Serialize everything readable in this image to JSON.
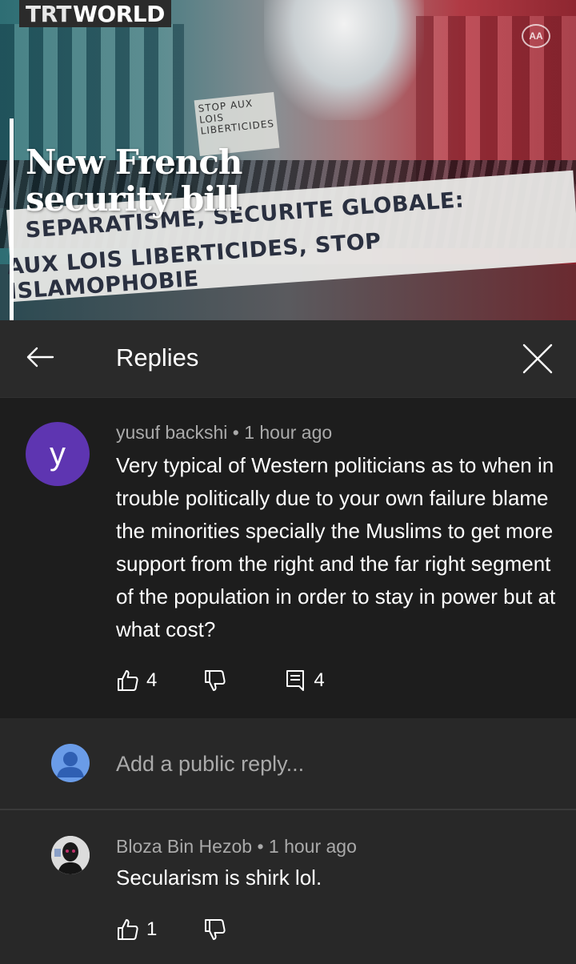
{
  "video": {
    "logo": {
      "trt": "TRT",
      "world": "WORLD"
    },
    "badge": "AA",
    "headline_line1": "New French",
    "headline_line2": "security bill",
    "placard_text": "STOP AUX LOIS LIBERTICIDES",
    "banner_line1": "SEPARATISME, SECURITE GLOBALE:",
    "banner_line2": "AUX LOIS LIBERTICIDES, STOP ISLAMOPHOBIE"
  },
  "header": {
    "title": "Replies",
    "back_icon": "arrow-left-icon",
    "close_icon": "close-icon"
  },
  "comment": {
    "avatar_letter": "y",
    "avatar_color": "#5e35b1",
    "author": "yusuf backshi",
    "separator": "•",
    "time": "1 hour ago",
    "text": "Very typical of Western politicians as to when in trouble politically due to your own failure blame the minorities specially the Muslims to get more support from the right and the far right segment of the population in order to stay in power but at what cost?",
    "likes": "4",
    "replies": "4"
  },
  "add_reply": {
    "placeholder": "Add a public reply..."
  },
  "reply": {
    "author": "Bloza Bin Hezob",
    "separator": "•",
    "time": "1 hour ago",
    "text": "Secularism is shirk lol.",
    "likes": "1"
  }
}
